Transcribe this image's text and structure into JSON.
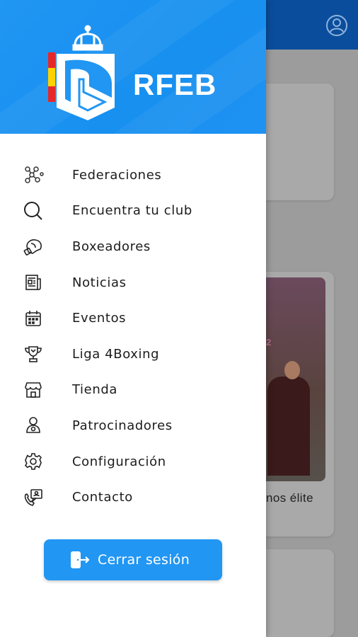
{
  "app": {
    "logo_text": "RFEB",
    "brand_color": "#2196f3",
    "topbar_color": "#0a4d9c"
  },
  "background": {
    "card_caption": "nos élite",
    "photo_year_text": "-2022"
  },
  "menu": {
    "items": [
      {
        "label": "Federaciones",
        "icon": "federations-network-icon"
      },
      {
        "label": "Encuentra tu club",
        "icon": "search-icon"
      },
      {
        "label": "Boxeadores",
        "icon": "boxing-glove-icon"
      },
      {
        "label": "Noticias",
        "icon": "newspaper-icon"
      },
      {
        "label": "Eventos",
        "icon": "calendar-icon"
      },
      {
        "label": "Liga 4Boxing",
        "icon": "trophy-icon"
      },
      {
        "label": "Tienda",
        "icon": "store-icon"
      },
      {
        "label": "Patrocinadores",
        "icon": "sponsor-icon"
      },
      {
        "label": "Configuración",
        "icon": "gear-icon"
      },
      {
        "label": "Contacto",
        "icon": "contact-phone-icon"
      }
    ]
  },
  "logout": {
    "label": "Cerrar sesión",
    "icon": "logout-icon"
  }
}
